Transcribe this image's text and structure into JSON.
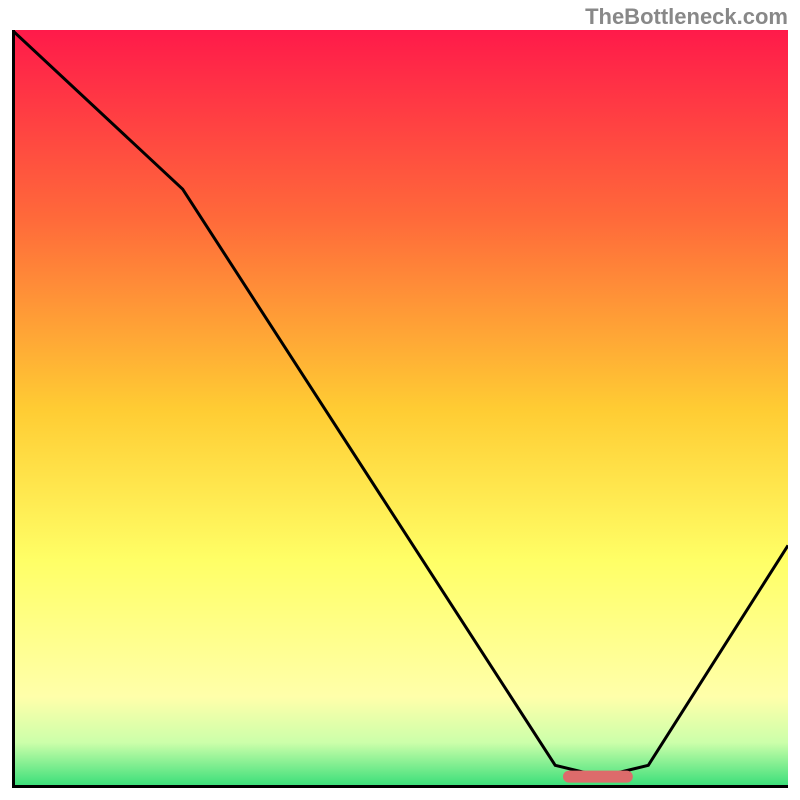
{
  "watermark": "TheBottleneck.com",
  "chart_data": {
    "type": "line",
    "title": "",
    "xlabel": "",
    "ylabel": "",
    "xlim": [
      0,
      100
    ],
    "ylim": [
      0,
      100
    ],
    "gradient": {
      "stops": [
        {
          "offset": 0,
          "color": "#ff1a4a"
        },
        {
          "offset": 25,
          "color": "#ff6a3a"
        },
        {
          "offset": 50,
          "color": "#ffcc33"
        },
        {
          "offset": 70,
          "color": "#ffff66"
        },
        {
          "offset": 88,
          "color": "#ffffaa"
        },
        {
          "offset": 94,
          "color": "#ccffaa"
        },
        {
          "offset": 100,
          "color": "#33dd77"
        }
      ]
    },
    "curve": [
      {
        "x": 0,
        "y": 100
      },
      {
        "x": 22,
        "y": 79
      },
      {
        "x": 70,
        "y": 3
      },
      {
        "x": 76,
        "y": 1.5
      },
      {
        "x": 82,
        "y": 3
      },
      {
        "x": 100,
        "y": 32
      }
    ],
    "marker": {
      "x_start": 71,
      "x_end": 80,
      "y": 1.5,
      "color": "#dd6b6b"
    },
    "axes_color": "#000000"
  }
}
